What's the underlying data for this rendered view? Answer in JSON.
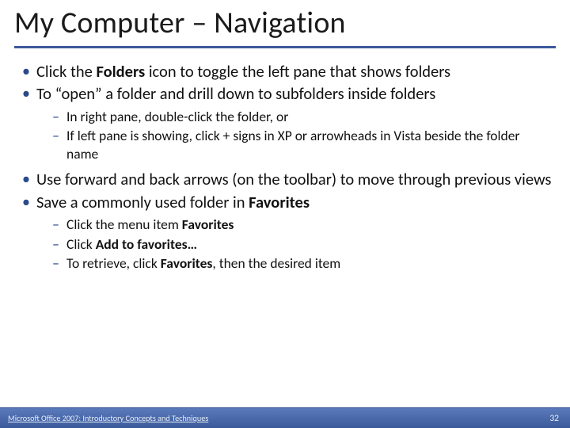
{
  "title": "My Computer – Navigation",
  "bullets": {
    "b1_pre": "Click the ",
    "b1_bold": "Folders",
    "b1_post": " icon to toggle the left pane that shows folders",
    "b2": "To “open” a folder and drill down to subfolders inside folders",
    "b2_sub1": "In right pane, double-click the folder, or",
    "b2_sub2": "If left pane is showing, click + signs in XP or arrowheads in Vista beside the folder name",
    "b3": "Use forward and back arrows (on the toolbar) to move through previous views",
    "b4_pre": "Save a commonly used folder in ",
    "b4_bold": "Favorites",
    "b4_sub1_pre": "Click the menu item ",
    "b4_sub1_bold": "Favorites",
    "b4_sub2_pre": "Click ",
    "b4_sub2_bold": "Add to favorites…",
    "b4_sub3_pre": "To retrieve, click ",
    "b4_sub3_bold": "Favorites",
    "b4_sub3_post": ", then the desired item"
  },
  "footer": {
    "text": "Microsoft Office 2007: Introductory Concepts and Techniques",
    "page": "32"
  }
}
